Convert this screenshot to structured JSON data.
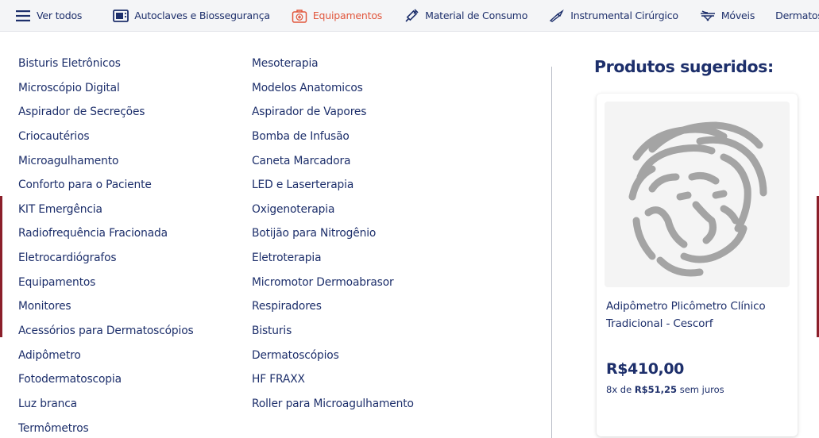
{
  "nav": {
    "all": "Ver todos",
    "items": [
      {
        "label": "Autoclaves e Biossegurança",
        "icon": "autoclave-icon"
      },
      {
        "label": "Equipamentos",
        "icon": "medkit-icon",
        "active": true
      },
      {
        "label": "Material de Consumo",
        "icon": "syringe-icon"
      },
      {
        "label": "Instrumental Cirúrgico",
        "icon": "scalpel-icon"
      },
      {
        "label": "Móveis",
        "icon": "stretcher-icon"
      },
      {
        "label": "Dermatoscópios",
        "icon": ""
      }
    ],
    "active_color": "#e1563c",
    "text_color": "#1d2f6b"
  },
  "menu": {
    "column1": [
      "Bisturis Eletrônicos",
      "Microscópio Digital",
      "Aspirador de Secreções",
      "Criocautérios",
      "Microagulhamento",
      "Conforto para o Paciente",
      "KIT Emergência",
      "Radiofrequência Fracionada",
      "Eletrocardiógrafos",
      "Equipamentos",
      "Monitores",
      "Acessórios para Dermatoscópios",
      "Adipômetro",
      "Fotodermatoscopia",
      "Luz branca",
      "Termômetros"
    ],
    "column2": [
      "Mesoterapia",
      "Modelos Anatomicos",
      "Aspirador de Vapores",
      "Bomba de Infusão",
      "Caneta Marcadora",
      "LED e Laserterapia",
      "Oxigenoterapia",
      "Botijão para Nitrogênio",
      "Eletroterapia",
      "Micromotor Dermoabrasor",
      "Respiradores",
      "Bisturis",
      "Dermatoscópios",
      "HF FRAXX",
      "Roller para Microagulhamento"
    ]
  },
  "suggested": {
    "title": "Produtos sugeridos:",
    "product": {
      "name": "Adipômetro Plicômetro Clínico Tradicional - Cescorf",
      "price": "R$410,00",
      "installments_prefix": "8x de",
      "installment_value": "R$51,25",
      "installments_suffix": "sem juros",
      "image_icon": "lion-logo-placeholder"
    }
  }
}
